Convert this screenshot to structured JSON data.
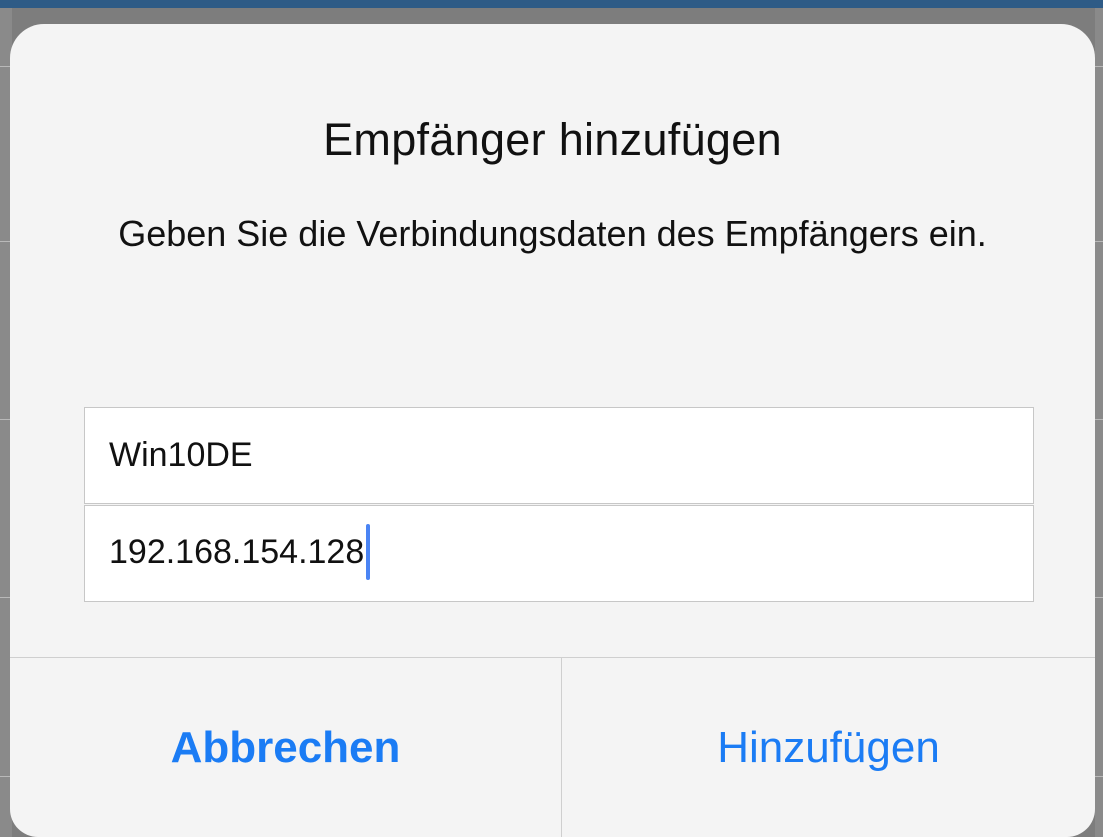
{
  "dialog": {
    "title": "Empfänger hinzufügen",
    "message": "Geben Sie die Verbindungsdaten des Empfängers ein.",
    "fields": [
      {
        "value": "Win10DE"
      },
      {
        "value": "192.168.154.128"
      }
    ],
    "buttons": {
      "cancel_label": "Abbrechen",
      "confirm_label": "Hinzufügen"
    }
  },
  "colors": {
    "accent": "#1b7cf4",
    "caret": "#4a84f4",
    "dialog_background": "#f4f4f4",
    "top_strip": "#2e5b86"
  }
}
